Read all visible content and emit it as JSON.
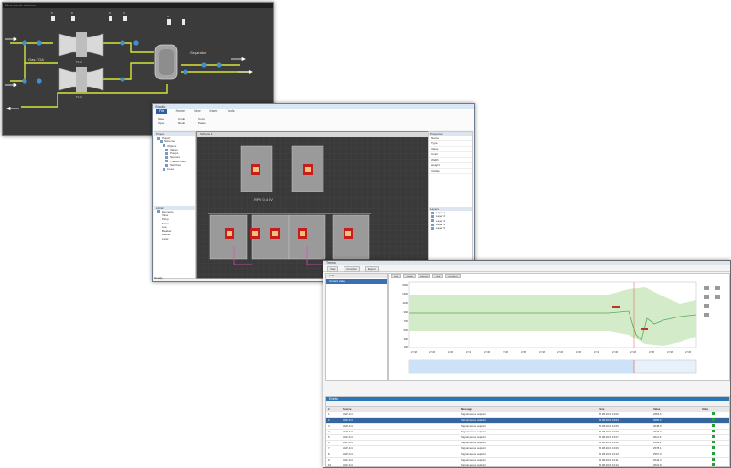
{
  "scheme_window": {
    "title": "Mnemonic scheme",
    "labels": [
      "Gas-TGA",
      "Separator",
      "TG-1",
      "TG-2"
    ],
    "arrow_marks": [
      "5",
      "9",
      "8",
      "3",
      "3"
    ]
  },
  "editor_window": {
    "title": "Studio",
    "ribbon_tabs": [
      "File",
      "Home",
      "View",
      "Insert",
      "Tools"
    ],
    "ribbon_buttons": [
      "Save",
      "Open",
      "Undo",
      "Redo",
      "Copy",
      "Paste"
    ],
    "left_panel_title": "Project",
    "tree_items": [
      "Project",
      "Scheme",
      "Objects",
      "Valves",
      "Pumps",
      "Sensors",
      "Transformers",
      "Switches",
      "Lines"
    ],
    "left_lower_title": "Library",
    "lower_tree_items": [
      "Elements",
      "Valve",
      "Pump",
      "Motor",
      "Line",
      "Breaker",
      "Busbar",
      "Label"
    ],
    "canvas_tab": "Scheme 1",
    "canvas_label": "RPU 0,4 kV",
    "right_panel_title": "Properties",
    "properties": [
      "Name",
      "Type",
      "Value",
      "Color",
      "Width",
      "Height",
      "Visible"
    ],
    "right_lower_title": "Layers",
    "layers": [
      "Layer 1",
      "Layer 2",
      "Layer 3",
      "Layer 4",
      "Layer 5"
    ],
    "status": "Ready"
  },
  "trends_window": {
    "title": "Trends",
    "toolbar": [
      "View",
      "Function",
      "Export"
    ],
    "left_header": "Add",
    "selected_item": "Current value",
    "chart_tabs": [
      "Day",
      "Week",
      "Month",
      "Year",
      "Custom"
    ],
    "y_ticks": [
      "1500",
      "1300",
      "1100",
      "900",
      "700",
      "500",
      "300",
      "100"
    ],
    "x_ticks": [
      "27.08",
      "27.08",
      "27.08",
      "27.08",
      "27.08",
      "27.08",
      "27.08",
      "27.08",
      "27.08",
      "27.08",
      "27.08",
      "27.08",
      "27.08",
      "27.08",
      "27.08",
      "27.08"
    ],
    "events_title": "Events",
    "events_columns": [
      "#",
      "Source",
      "Message",
      "Time",
      "Value",
      "State"
    ],
    "events_rows": [
      [
        "1",
        "AGP-1/4",
        "Signal above setpoint",
        "26.08.2016 13:02",
        "2684.6",
        ""
      ],
      [
        "2",
        "AGP-1/4",
        "Signal above setpoint",
        "26.08.2016 13:04",
        "2650.0",
        ""
      ],
      [
        "3",
        "AGP-1/4",
        "Signal above setpoint",
        "26.08.2016 13:05",
        "2648.0",
        ""
      ],
      [
        "4",
        "AGP-1/4",
        "Signal above setpoint",
        "26.08.2016 13:06",
        "2623.4",
        ""
      ],
      [
        "5",
        "AGP-1/4",
        "Signal above setpoint",
        "26.08.2016 13:07",
        "2611.9",
        ""
      ],
      [
        "6",
        "AGP-1/4",
        "Signal above setpoint",
        "26.08.2016 13:08",
        "2599.2",
        ""
      ],
      [
        "7",
        "AGP-1/4",
        "Signal above setpoint",
        "26.08.2016 13:09",
        "2578.1",
        ""
      ],
      [
        "8",
        "AGP-1/4",
        "Signal above setpoint",
        "26.08.2016 13:10",
        "2567.0",
        ""
      ],
      [
        "9",
        "AGP-1/4",
        "Signal above setpoint",
        "26.08.2016 13:11",
        "2544.3",
        ""
      ],
      [
        "10",
        "AGP-1/4",
        "Signal above setpoint",
        "26.08.2016 13:12",
        "2531.8",
        ""
      ],
      [
        "11",
        "AGP-1/4",
        "Signal above setpoint",
        "26.08.2016 13:13",
        "2519.5",
        ""
      ],
      [
        "12",
        "AGP-1/4",
        "Signal above setpoint",
        "26.08.2016 13:14",
        "2502.2",
        ""
      ]
    ]
  },
  "colors": {
    "scheme_bg": "#3b3b3b",
    "line_yellow": "#d6e53a",
    "chart_band": "#cfe9c4",
    "chart_line": "#5aab5a",
    "selection": "#36649e"
  }
}
